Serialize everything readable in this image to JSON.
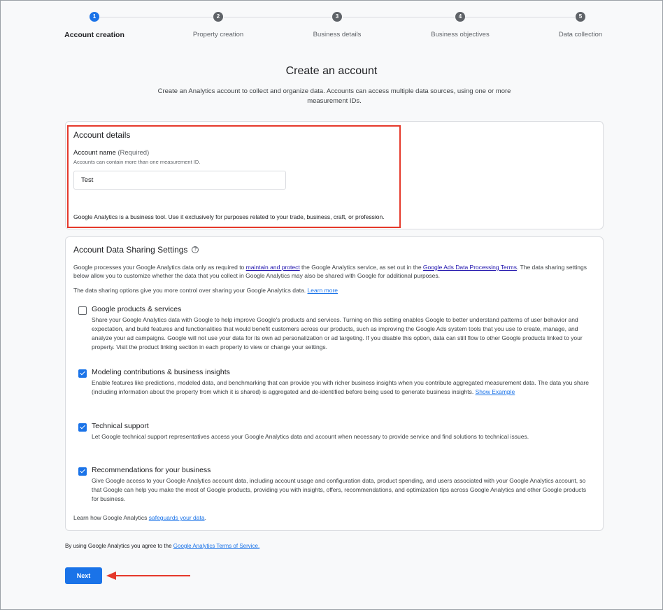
{
  "stepper": {
    "steps": [
      {
        "num": "1",
        "label": "Account creation"
      },
      {
        "num": "2",
        "label": "Property creation"
      },
      {
        "num": "3",
        "label": "Business details"
      },
      {
        "num": "4",
        "label": "Business objectives"
      },
      {
        "num": "5",
        "label": "Data collection"
      }
    ]
  },
  "header": {
    "title": "Create an account",
    "subtitle": "Create an Analytics account to collect and organize data. Accounts can access multiple data sources, using one or more measurement IDs."
  },
  "account_details": {
    "title": "Account details",
    "name_label": "Account name",
    "required": "(Required)",
    "hint": "Accounts can contain more than one measurement ID.",
    "name_value": "Test",
    "business_note": "Google Analytics is a business tool. Use it exclusively for purposes related to your trade, business, craft, or profession."
  },
  "sharing": {
    "title": "Account Data Sharing Settings",
    "intro_1": "Google processes your Google Analytics data only as required to ",
    "intro_link_1": "maintain and protect",
    "intro_2": " the Google Analytics service, as set out in the ",
    "intro_link_2": "Google Ads Data Processing Terms",
    "intro_3": ". The data sharing settings below allow you to customize whether the data that you collect in Google Analytics may also be shared with Google for additional purposes.",
    "control_text": "The data sharing options give you more control over sharing your Google Analytics data. ",
    "learn_more": "Learn more",
    "options": [
      {
        "title": "Google products & services",
        "checked": false,
        "desc": "Share your Google Analytics data with Google to help improve Google's products and services. Turning on this setting enables Google to better understand patterns of user behavior and expectation, and build features and functionalities that would benefit customers across our products, such as improving the Google Ads system tools that you use to create, manage, and analyze your ad campaigns. Google will not use your data for its own ad personalization or ad targeting. If you disable this option, data can still flow to other Google products linked to your property. Visit the product linking section in each property to view or change your settings."
      },
      {
        "title": "Modeling contributions & business insights",
        "checked": true,
        "desc": "Enable features like predictions, modeled data, and benchmarking that can provide you with richer business insights when you contribute aggregated measurement data. The data you share (including information about the property from which it is shared) is aggregated and de-identified before being used to generate business insights. ",
        "link": "Show Example"
      },
      {
        "title": "Technical support",
        "checked": true,
        "desc": "Let Google technical support representatives access your Google Analytics data and account when necessary to provide service and find solutions to technical issues."
      },
      {
        "title": "Recommendations for your business",
        "checked": true,
        "desc": "Give Google access to your Google Analytics account data, including account usage and configuration data, product spending, and users associated with your Google Analytics account, so that Google can help you make the most of Google products, providing you with insights, offers, recommendations, and optimization tips across Google Analytics and other Google products for business."
      }
    ],
    "footer_text": "Learn how Google Analytics ",
    "footer_link": "safeguards your data",
    "footer_end": "."
  },
  "tos": {
    "text": "By using Google Analytics you agree to the ",
    "link": "Google Analytics Terms of Service."
  },
  "next_label": "Next",
  "colors": {
    "accent": "#1a73e8",
    "highlight": "#e5392b"
  }
}
